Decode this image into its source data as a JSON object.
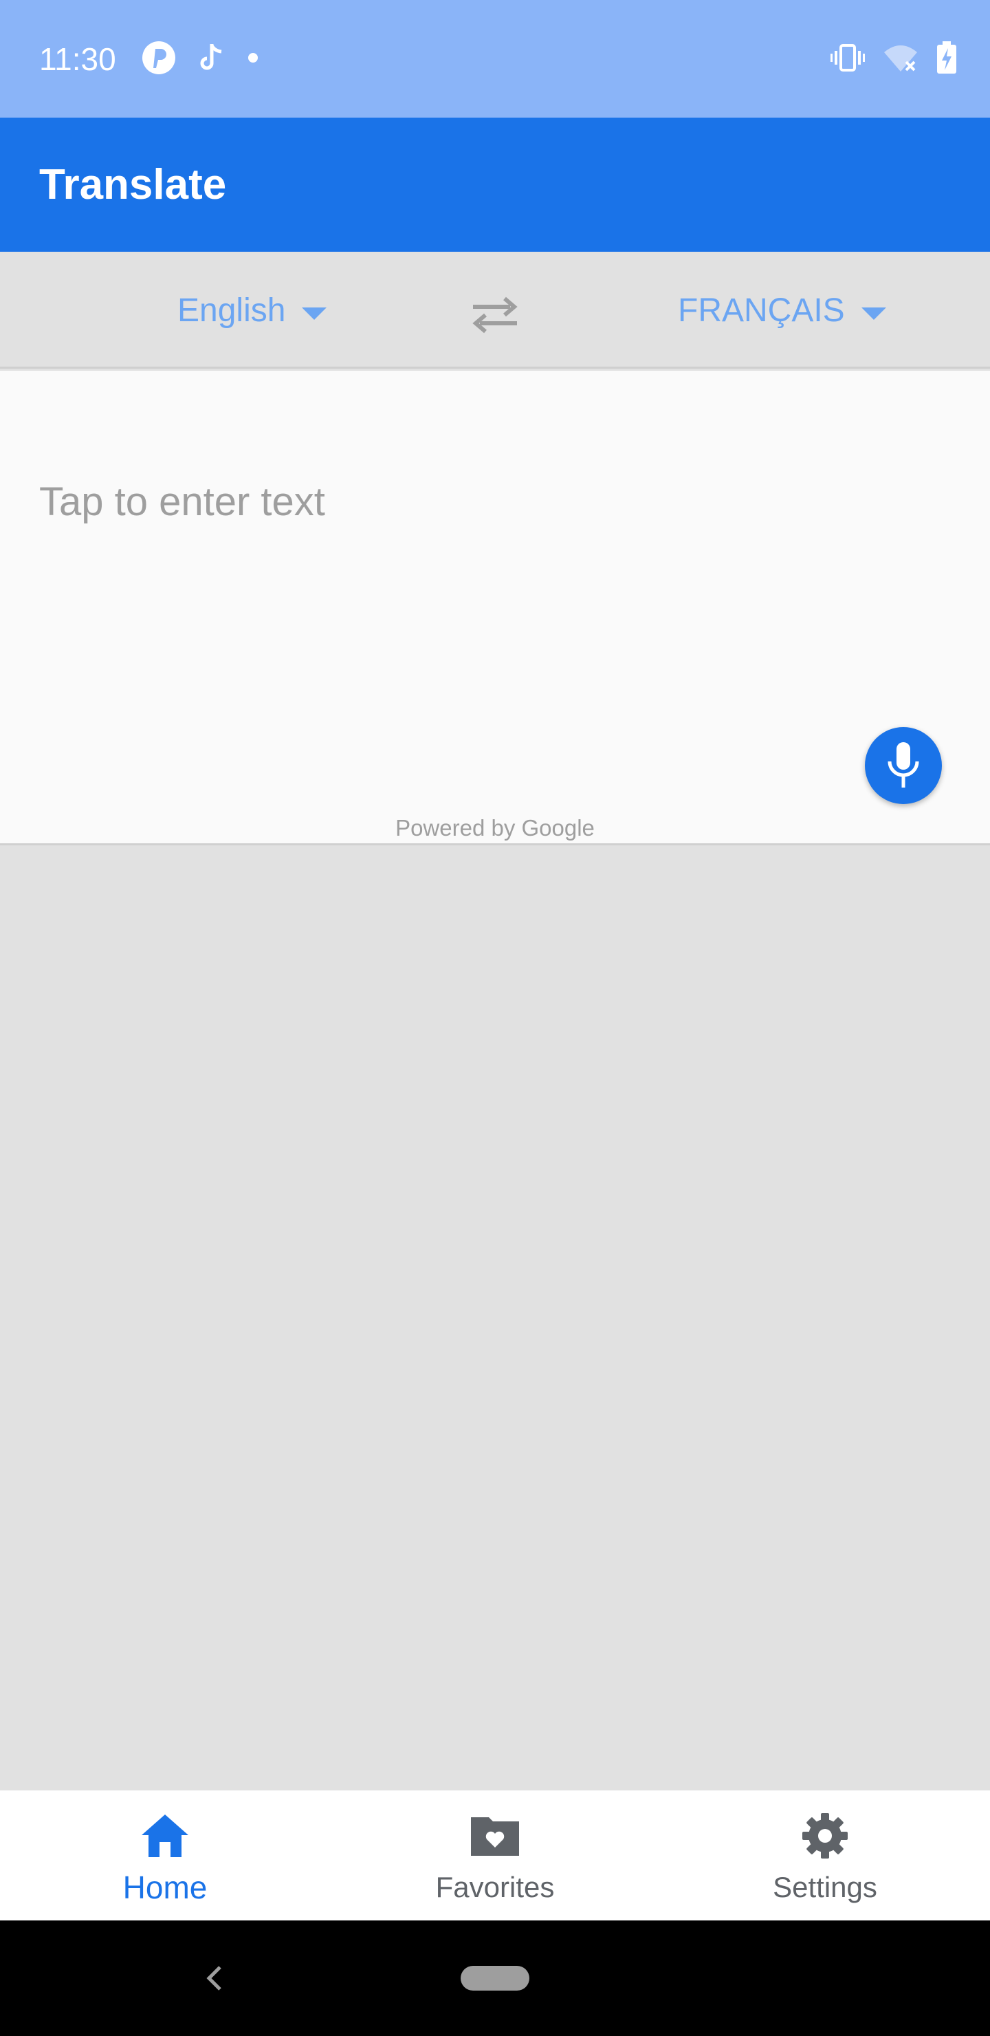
{
  "status_bar": {
    "time": "11:30",
    "left_icons": [
      "pinterest-icon",
      "tiktok-icon",
      "dot-icon"
    ],
    "right_icons": [
      "vibrate-icon",
      "wifi-off-icon",
      "battery-charging-icon"
    ]
  },
  "app_bar": {
    "title": "Translate"
  },
  "language_bar": {
    "source_language": "English",
    "target_language": "FRANÇAIS",
    "swap_icon": "swap-icon"
  },
  "input_panel": {
    "placeholder": "Tap to enter text",
    "powered_by": "Powered by Google",
    "mic_icon": "microphone-icon"
  },
  "bottom_nav": {
    "items": [
      {
        "label": "Home",
        "icon": "home-icon",
        "active": true
      },
      {
        "label": "Favorites",
        "icon": "favorites-folder-icon",
        "active": false
      },
      {
        "label": "Settings",
        "icon": "gear-icon",
        "active": false
      }
    ]
  },
  "colors": {
    "status_bar": "#8ab4f8",
    "primary": "#1a73e8",
    "language_link": "#6ba5f2",
    "background": "#e1e1e1"
  }
}
